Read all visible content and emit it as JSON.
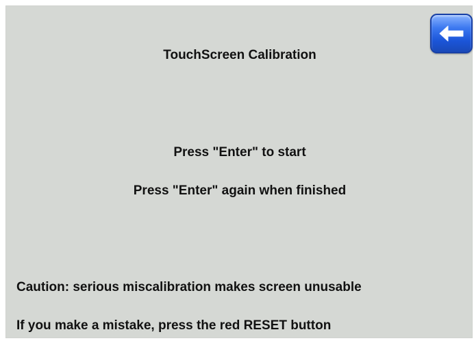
{
  "header": {
    "title": "TouchScreen Calibration",
    "back_icon": "arrow-left-icon",
    "accent_color": "#2a63e0"
  },
  "instructions": {
    "start": "Press \"Enter\" to start",
    "finish": "Press \"Enter\" again when finished"
  },
  "warnings": {
    "caution": "Caution: serious miscalibration makes screen unusable",
    "reset": "If you make a mistake, press the red RESET button"
  },
  "background_color": "#d5d8d4"
}
